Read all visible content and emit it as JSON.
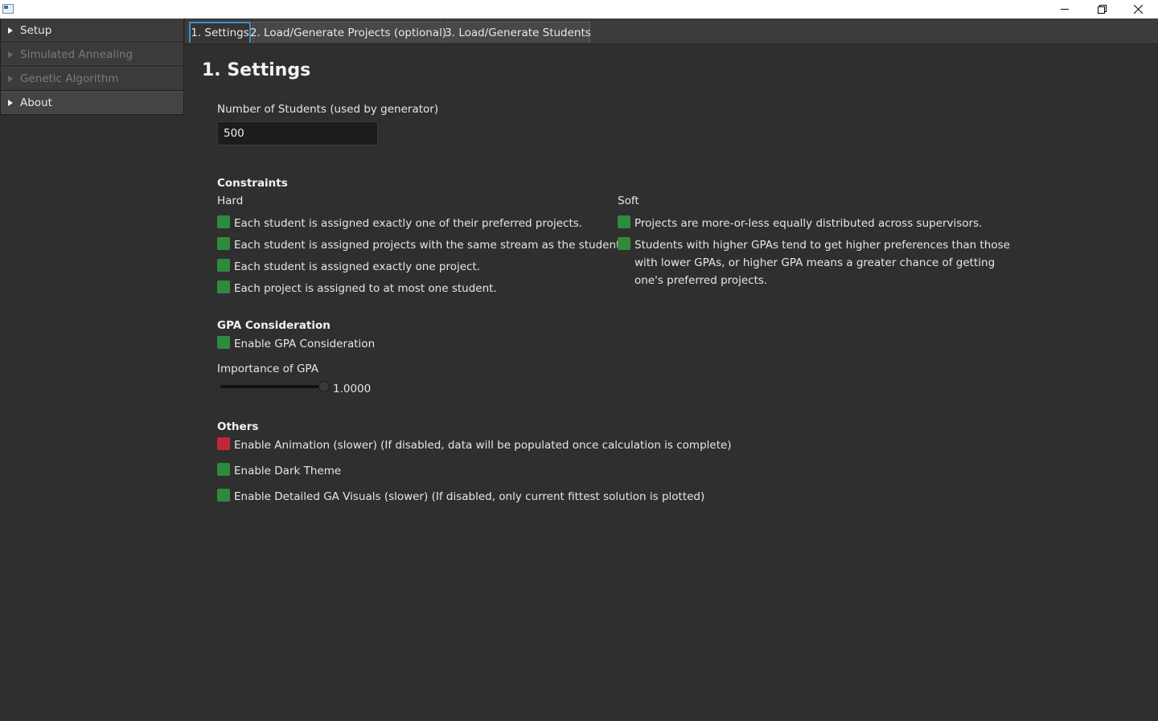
{
  "sidebar": {
    "items": [
      {
        "label": "Setup"
      },
      {
        "label": "Simulated Annealing"
      },
      {
        "label": "Genetic Algorithm"
      },
      {
        "label": "About"
      }
    ]
  },
  "tabs": [
    {
      "label": "1. Settings"
    },
    {
      "label": "2. Load/Generate Projects (optional)"
    },
    {
      "label": "3. Load/Generate Students"
    }
  ],
  "page": {
    "title": "1. Settings",
    "num_students_label": "Number of Students (used by generator)",
    "num_students_value": "500"
  },
  "constraints": {
    "title": "Constraints",
    "hard_label": "Hard",
    "soft_label": "Soft",
    "hard": [
      {
        "label": "Each student is assigned exactly one of their preferred projects."
      },
      {
        "label": "Each student is assigned projects with the same stream as the student."
      },
      {
        "label": "Each student is assigned exactly one project."
      },
      {
        "label": "Each project is assigned to at most one student."
      }
    ],
    "soft": [
      {
        "label": "Projects are more-or-less equally distributed across supervisors."
      },
      {
        "label": "Students with higher GPAs tend to get higher preferences than those with lower GPAs, or higher GPA means a greater chance of getting one's preferred projects."
      }
    ]
  },
  "gpa": {
    "title": "GPA Consideration",
    "enable_label": "Enable GPA Consideration",
    "importance_label": "Importance of GPA",
    "importance_value_text": "1.0000",
    "importance_value": 1.0
  },
  "others": {
    "title": "Others",
    "items": [
      {
        "label": "Enable Animation (slower) (If disabled, data will be populated once calculation is complete)"
      },
      {
        "label": "Enable Dark Theme"
      },
      {
        "label": "Enable Detailed GA Visuals (slower) (If disabled, only current fittest solution is plotted)"
      }
    ]
  },
  "colors": {
    "checked": "#2e8b3e",
    "unchecked": "#c0283a",
    "tab_accent": "#3e8fc7",
    "background": "#2f2f2f"
  }
}
